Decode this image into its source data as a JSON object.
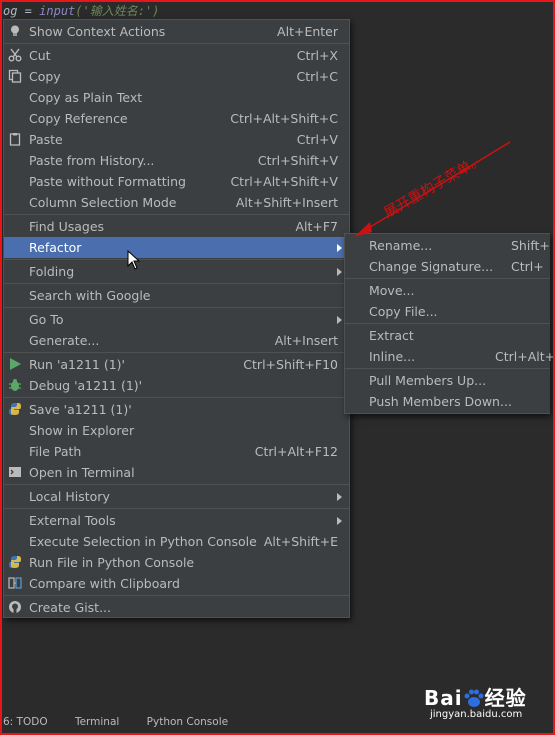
{
  "editor": {
    "code_var": "og",
    "code_op": " = ",
    "code_fn": "input",
    "code_arg": "('输入姓名:')"
  },
  "context_menu": {
    "items": [
      {
        "icon": "bulb",
        "label": "Show Context Actions",
        "shortcut": "Alt+Enter"
      },
      {
        "icon": "cut",
        "label": "Cut",
        "shortcut": "Ctrl+X"
      },
      {
        "icon": "copy",
        "label": "Copy",
        "shortcut": "Ctrl+C"
      },
      {
        "icon": "",
        "label": "Copy as Plain Text",
        "shortcut": ""
      },
      {
        "icon": "",
        "label": "Copy Reference",
        "shortcut": "Ctrl+Alt+Shift+C"
      },
      {
        "icon": "paste",
        "label": "Paste",
        "shortcut": "Ctrl+V"
      },
      {
        "icon": "",
        "label": "Paste from History...",
        "shortcut": "Ctrl+Shift+V"
      },
      {
        "icon": "",
        "label": "Paste without Formatting",
        "shortcut": "Ctrl+Alt+Shift+V"
      },
      {
        "icon": "",
        "label": "Column Selection Mode",
        "shortcut": "Alt+Shift+Insert"
      },
      {
        "icon": "",
        "label": "Find Usages",
        "shortcut": "Alt+F7"
      },
      {
        "icon": "",
        "label": "Refactor",
        "shortcut": ""
      },
      {
        "icon": "",
        "label": "Folding",
        "shortcut": ""
      },
      {
        "icon": "",
        "label": "Search with Google",
        "shortcut": ""
      },
      {
        "icon": "",
        "label": "Go To",
        "shortcut": ""
      },
      {
        "icon": "",
        "label": "Generate...",
        "shortcut": "Alt+Insert"
      },
      {
        "icon": "run",
        "label": "Run 'a1211 (1)'",
        "shortcut": "Ctrl+Shift+F10"
      },
      {
        "icon": "debug",
        "label": "Debug 'a1211 (1)'",
        "shortcut": ""
      },
      {
        "icon": "python",
        "label": "Save 'a1211 (1)'",
        "shortcut": ""
      },
      {
        "icon": "",
        "label": "Show in Explorer",
        "shortcut": ""
      },
      {
        "icon": "",
        "label": "File Path",
        "shortcut": "Ctrl+Alt+F12"
      },
      {
        "icon": "terminal",
        "label": "Open in Terminal",
        "shortcut": ""
      },
      {
        "icon": "",
        "label": "Local History",
        "shortcut": ""
      },
      {
        "icon": "",
        "label": "External Tools",
        "shortcut": ""
      },
      {
        "icon": "",
        "label": "Execute Selection in Python Console",
        "shortcut": "Alt+Shift+E"
      },
      {
        "icon": "python",
        "label": "Run File in Python Console",
        "shortcut": ""
      },
      {
        "icon": "compare",
        "label": "Compare with Clipboard",
        "shortcut": ""
      },
      {
        "icon": "github",
        "label": "Create Gist...",
        "shortcut": ""
      }
    ],
    "selected_label": "Refactor"
  },
  "refactor_submenu": {
    "items": [
      {
        "label": "Rename...",
        "shortcut": "Shift+"
      },
      {
        "label": "Change Signature...",
        "shortcut": "Ctrl+"
      },
      {
        "label": "Move...",
        "shortcut": ""
      },
      {
        "label": "Copy File...",
        "shortcut": ""
      },
      {
        "label": "Extract",
        "shortcut": ""
      },
      {
        "label": "Inline...",
        "shortcut": "Ctrl+Alt+"
      },
      {
        "label": "Pull Members Up...",
        "shortcut": ""
      },
      {
        "label": "Push Members Down...",
        "shortcut": ""
      }
    ]
  },
  "annotation": {
    "text": "展开重构子菜单。",
    "color": "#cc1111"
  },
  "status_bar": {
    "todo": "6: TODO",
    "terminal": "Terminal",
    "python_console": "Python Console"
  },
  "watermark": {
    "brand_latin": "Bai",
    "brand_cn": "经验",
    "site": "jingyan.baidu.com"
  },
  "colors": {
    "menu_bg": "#3c3f41",
    "selection": "#4b6eaf",
    "frame": "#e8151b"
  }
}
